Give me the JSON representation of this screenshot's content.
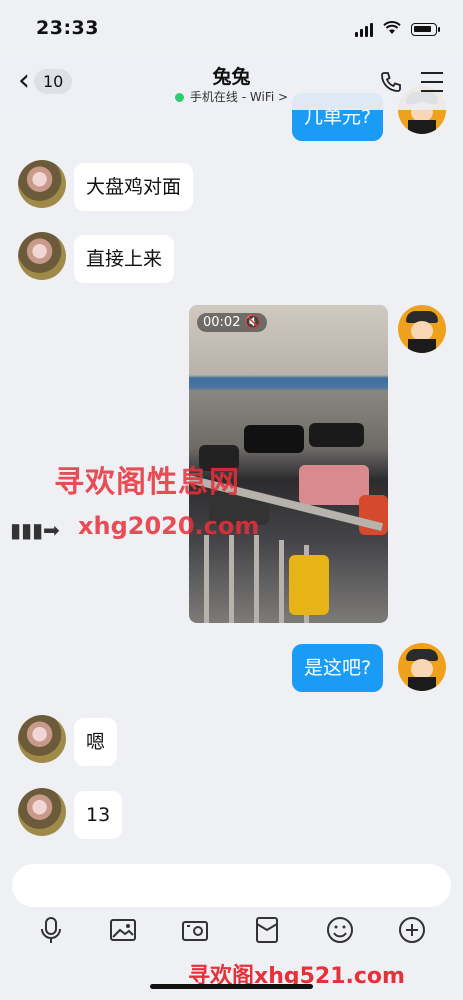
{
  "status_bar": {
    "time": "23:33"
  },
  "header": {
    "back_count": "10",
    "contact_name": "兔兔",
    "presence": "手机在线 - WiFi",
    "presence_chevron": ">"
  },
  "messages": [
    {
      "side": "right",
      "text": "几单元?"
    },
    {
      "side": "left",
      "text": "大盘鸡对面"
    },
    {
      "side": "left",
      "text": "直接上来"
    },
    {
      "side": "right",
      "type": "video",
      "duration": "00:02"
    },
    {
      "side": "right",
      "text": "是这吧?"
    },
    {
      "side": "left",
      "text": "嗯"
    },
    {
      "side": "left",
      "text": "13"
    }
  ],
  "overlay": {
    "watermark_cn": "寻欢阁性息网",
    "watermark_url": "xhg2020.com",
    "bottom_watermark": "寻欢阁xhg521.com"
  },
  "toolbar": [
    "mic-icon",
    "image-icon",
    "camera-icon",
    "red-packet-icon",
    "emoji-icon",
    "plus-icon"
  ],
  "colors": {
    "bubble_right": "#1a9bf5",
    "online": "#2ecc71",
    "watermark": "#e8303a"
  }
}
